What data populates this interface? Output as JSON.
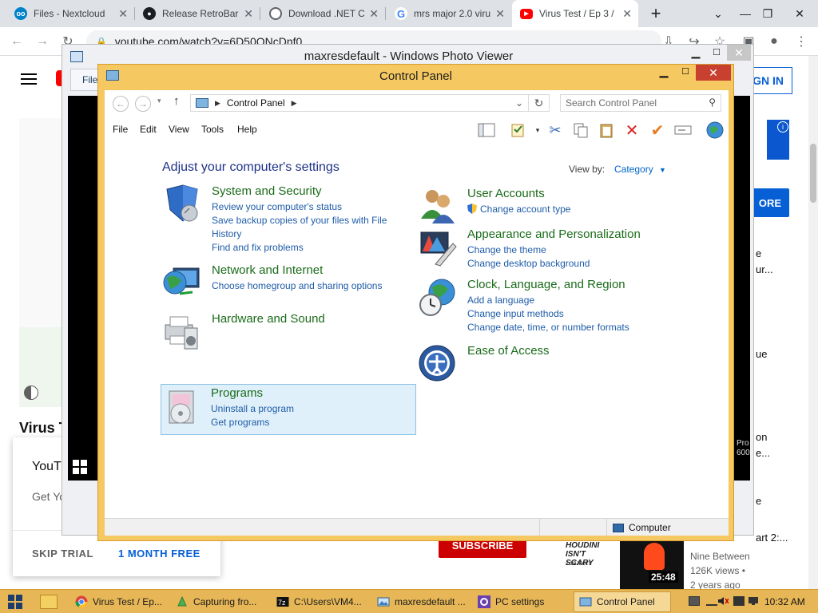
{
  "browser": {
    "tabs": [
      {
        "label": "Files - Nextcloud",
        "favicon": "nextcloud-icon"
      },
      {
        "label": "Release RetroBar",
        "favicon": "github-icon"
      },
      {
        "label": "Download .NET C",
        "favicon": "globe-icon"
      },
      {
        "label": "mrs major 2.0 viru",
        "favicon": "google-icon"
      },
      {
        "label": "Virus Test / Ep 3 /",
        "favicon": "youtube-icon",
        "active": true
      }
    ],
    "new_tab": "+",
    "url": "youtube.com/watch?v=6D50ONcDnf0"
  },
  "youtube": {
    "sign_in": "SIGN IN",
    "more_button": "ORE",
    "title_left": "Virus T",
    "side_texts": [
      "e",
      "ur...",
      "ue",
      "on",
      "e...",
      "e",
      "art 2:..."
    ],
    "subscribe": "SUBSCRIBE",
    "popup": {
      "title": "YouT",
      "subtitle": "Get Yo",
      "skip": "SKIP TRIAL",
      "free": "1 MONTH FREE"
    },
    "thumb": {
      "title_lines": [
        "HOUDINI",
        "ISN'T",
        "SCARY"
      ],
      "subtitle": "2 OBJECTS",
      "duration": "25:48"
    },
    "meta": {
      "channel": "Nine Between",
      "views": "126K views •",
      "age": "2 years ago"
    }
  },
  "photo_viewer": {
    "title": "maxresdefault - Windows Photo Viewer",
    "menu_label": "File",
    "overlay_text": [
      "Pro",
      "600"
    ]
  },
  "control_panel": {
    "title": "Control Panel",
    "address": "Control Panel",
    "search_placeholder": "Search Control Panel",
    "menu": [
      "File",
      "Edit",
      "View",
      "Tools",
      "Help"
    ],
    "heading": "Adjust your computer's settings",
    "view_by_label": "View by:",
    "view_by_value": "Category",
    "categories_left": [
      {
        "title": "System and Security",
        "icon": "security-shield-icon",
        "links": [
          "Review your computer's status",
          "Save backup copies of your files with File",
          "History",
          "Find and fix problems"
        ]
      },
      {
        "title": "Network and Internet",
        "icon": "network-globe-icon",
        "links": [
          "Choose homegroup and sharing options"
        ]
      },
      {
        "title": "Hardware and Sound",
        "icon": "printer-speaker-icon",
        "links": []
      },
      {
        "title": "Programs",
        "icon": "programs-disc-icon",
        "links": [
          "Uninstall a program",
          "Get programs"
        ]
      }
    ],
    "categories_right": [
      {
        "title": "User Accounts",
        "icon": "users-icon",
        "links": [
          "Change account type"
        ]
      },
      {
        "title": "Appearance and Personalization",
        "icon": "monitor-paint-icon",
        "links": [
          "Change the theme",
          "Change desktop background"
        ]
      },
      {
        "title": "Clock, Language, and Region",
        "icon": "clock-globe-icon",
        "links": [
          "Add a language",
          "Change input methods",
          "Change date, time, or number formats"
        ]
      },
      {
        "title": "Ease of Access",
        "icon": "ease-of-access-icon",
        "links": []
      }
    ],
    "status_text": "Computer"
  },
  "taskbar": {
    "tasks": [
      {
        "label": "Virus Test / Ep...",
        "icon": "chrome-icon"
      },
      {
        "label": "Capturing fro...",
        "icon": "greenshot-icon"
      },
      {
        "label": "C:\\Users\\VM4...",
        "icon": "7zip-icon"
      },
      {
        "label": "maxresdefault ...",
        "icon": "photo-viewer-icon"
      },
      {
        "label": "PC settings",
        "icon": "settings-icon"
      },
      {
        "label": "Control Panel",
        "icon": "control-panel-icon",
        "active": true
      }
    ],
    "clock": "10:32 AM"
  },
  "colors": {
    "window_frame": "#f6c861",
    "taskbar": "#e7b757",
    "category_title": "#1a6b1a",
    "link": "#1e5ca8",
    "heading": "#1e3287",
    "close_button": "#c84030"
  }
}
